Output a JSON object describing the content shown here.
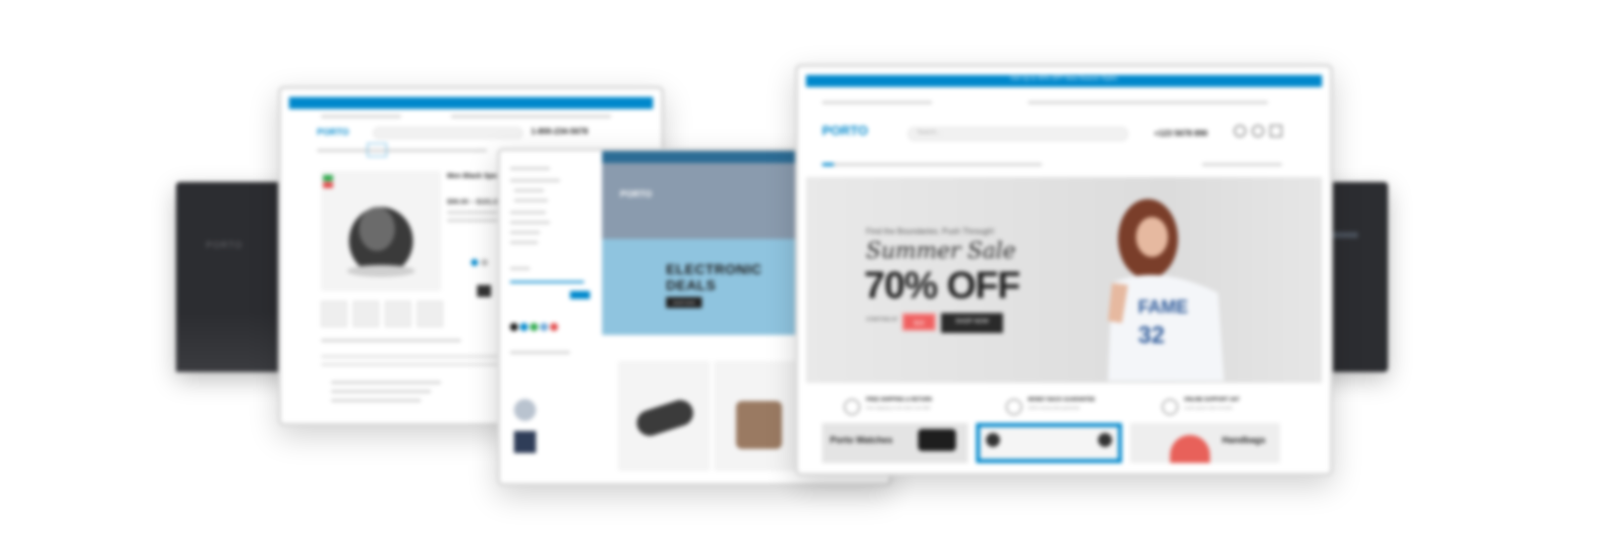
{
  "window_left": {
    "logo": "PORTO",
    "phone": "1-800-234-5678",
    "product_title": "Men Black Sports Shoes",
    "price": "$99.00 – $101.00"
  },
  "window_middle": {
    "logo": "PORTO",
    "promo_title_line1": "ELECTRONIC",
    "promo_title_line2": "DEALS",
    "promo_button": "SHOP NOW"
  },
  "window_main": {
    "topbar_text": "Get Up to 40% OFF New-Season Styles",
    "logo": "PORTO",
    "phone": "+123 5678 890",
    "search_placeholder": "Search...",
    "hero": {
      "kicker": "Find the Boundaries. Push Through!",
      "script_title": "Summer Sale",
      "headline": "70% OFF",
      "starting_label": "STARTING AT",
      "price_badge": "$19",
      "shop_button": "SHOP NOW"
    },
    "features": [
      {
        "title": "FREE SHIPPING & RETURN",
        "subtitle": "Free shipping on all orders over $99."
      },
      {
        "title": "MONEY BACK GUARANTEE",
        "subtitle": "100% money back guarantee"
      },
      {
        "title": "ONLINE SUPPORT 24/7",
        "subtitle": "Lorem ipsum dolor sit amet."
      }
    ],
    "banners": [
      "Porto Watches",
      "",
      "Handbags"
    ]
  },
  "colors": {
    "accent": "#0088cc",
    "sale_red": "#f06060",
    "dark_panel": "#2c2d31",
    "promo_blue": "#8fc4df"
  }
}
